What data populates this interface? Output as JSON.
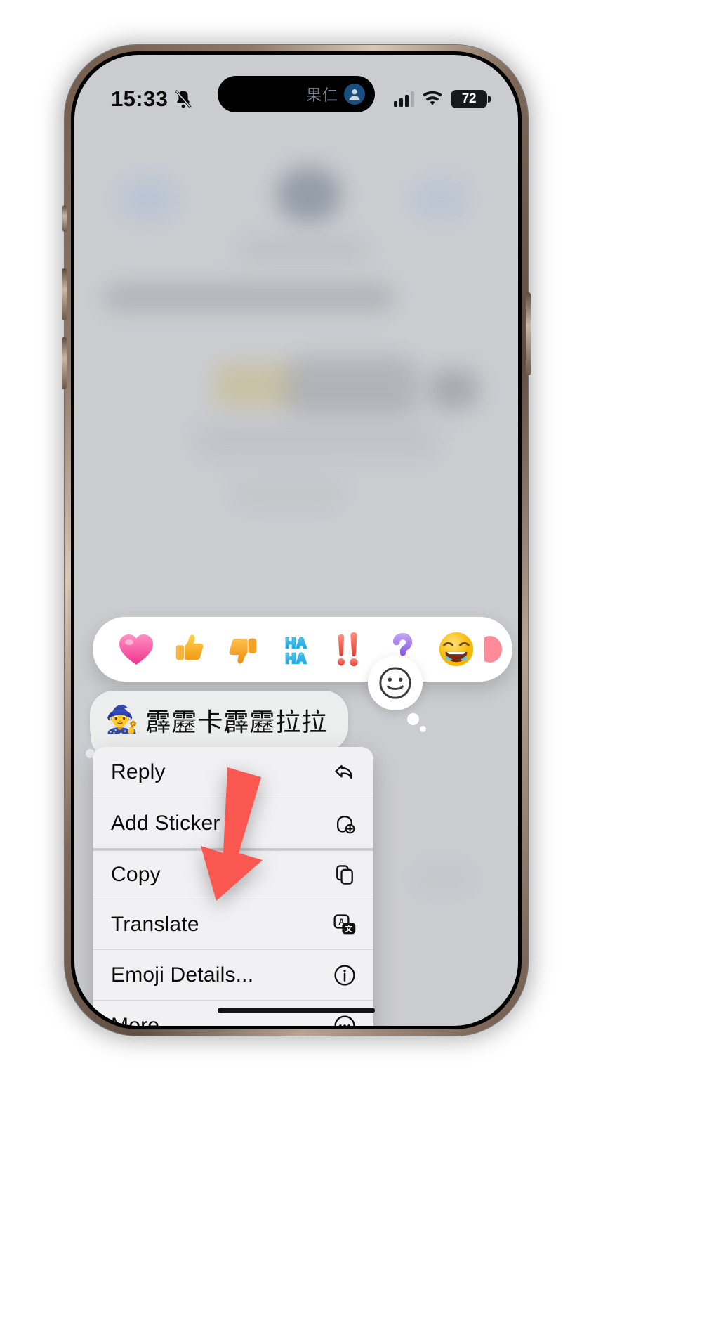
{
  "status_bar": {
    "time": "15:33",
    "mute_icon": "bell-slash-icon",
    "signal_icon": "cellular-signal-icon",
    "wifi_icon": "wifi-icon",
    "battery_percent": "72",
    "battery_icon": "battery-icon"
  },
  "dynamic_island": {
    "contact_name": "果仁",
    "avatar_icon": "person-avatar-icon"
  },
  "tapbacks": {
    "items": [
      {
        "name": "heart",
        "icon": "heart-tapback-icon",
        "glyph": "❤️",
        "color": "#FF4FA3"
      },
      {
        "name": "thumbs-up",
        "icon": "thumbs-up-tapback-icon",
        "glyph": "👍",
        "color": "#F5A623"
      },
      {
        "name": "thumbs-down",
        "icon": "thumbs-down-tapback-icon",
        "glyph": "👎",
        "color": "#F5A623"
      },
      {
        "name": "haha",
        "icon": "haha-tapback-icon",
        "glyph": "HA HA",
        "color": "#31A8E0"
      },
      {
        "name": "exclamation",
        "icon": "exclamation-tapback-icon",
        "glyph": "‼️",
        "color": "#F4594E"
      },
      {
        "name": "question",
        "icon": "question-tapback-icon",
        "glyph": "❓",
        "color": "#A07FE8"
      },
      {
        "name": "joy",
        "icon": "joy-emoji-icon",
        "glyph": "😂",
        "color": "#FFC83D"
      },
      {
        "name": "more-emoji",
        "icon": "more-emoji-partial-icon",
        "glyph": "",
        "color": "#FF8090"
      }
    ]
  },
  "message": {
    "emoji": "🧙",
    "text": "霹靂卡霹靂拉拉",
    "reaction_picker_icon": "smiley-face-icon"
  },
  "context_menu": {
    "items": [
      {
        "label": "Reply",
        "icon": "reply-arrow-icon"
      },
      {
        "label": "Add Sticker",
        "icon": "add-sticker-icon"
      },
      {
        "label": "Copy",
        "icon": "copy-icon"
      },
      {
        "label": "Translate",
        "icon": "translate-icon"
      },
      {
        "label": "Emoji Details...",
        "icon": "info-circle-icon"
      },
      {
        "label": "More...",
        "icon": "more-ellipsis-circle-icon"
      }
    ]
  },
  "annotation": {
    "arrow_icon": "red-arrow-icon",
    "arrow_color": "#F9574F",
    "points_to": "Emoji Details..."
  },
  "colors": {
    "screen_background": "#CFD0D4",
    "menu_background": "#F1F1F3",
    "bubble_background": "#ECEDED",
    "tapback_bar_background": "#FFFFFF"
  }
}
